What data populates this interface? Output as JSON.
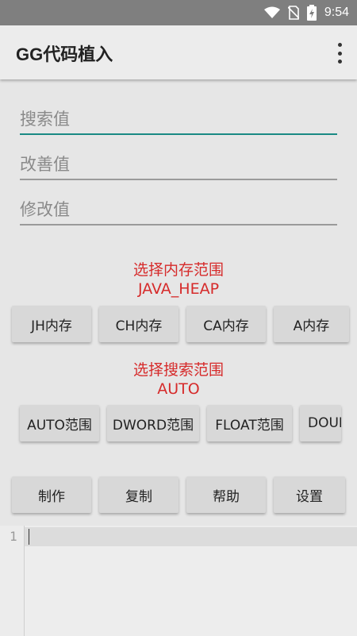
{
  "status_bar": {
    "time": "9:54",
    "icons": [
      "wifi-icon",
      "no-sim-icon",
      "battery-charging-icon"
    ]
  },
  "app_bar": {
    "title": "GG代码植入",
    "menu_icon": "overflow-menu-icon"
  },
  "inputs": {
    "search_placeholder": "搜索值",
    "improve_placeholder": "改善值",
    "modify_placeholder": "修改值"
  },
  "memory": {
    "label": "选择内存范围",
    "selected": "JAVA_HEAP",
    "buttons": [
      "JH内存",
      "CH内存",
      "CA内存",
      "A内存"
    ]
  },
  "search_range": {
    "label": "选择搜索范围",
    "selected": "AUTO",
    "buttons": [
      "AUTO范围",
      "DWORD范围",
      "FLOAT范围",
      "DOUB"
    ]
  },
  "actions": {
    "buttons": [
      "制作",
      "复制",
      "帮助",
      "设置"
    ]
  },
  "editor": {
    "line_number": "1"
  },
  "colors": {
    "accent": "#1a8a84",
    "label_red": "#d62b2b",
    "status_bar": "#7f7f7f"
  }
}
